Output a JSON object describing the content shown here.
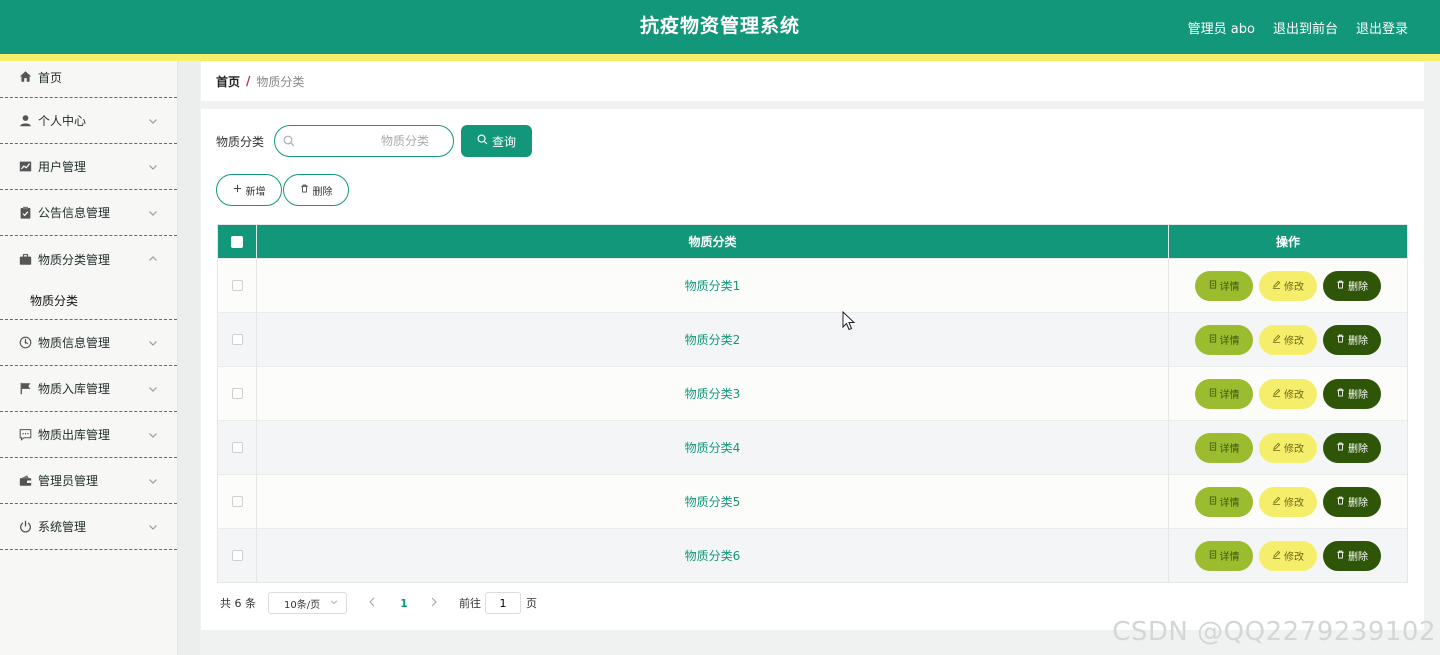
{
  "header": {
    "title": "抗疫物资管理系统",
    "admin_label": "管理员 abo",
    "back_to_front": "退出到前台",
    "logout": "退出登录"
  },
  "sidebar": {
    "items": [
      {
        "label": "首页",
        "icon": "home-icon"
      },
      {
        "label": "个人中心",
        "icon": "user-icon"
      },
      {
        "label": "用户管理",
        "icon": "chart-icon"
      },
      {
        "label": "公告信息管理",
        "icon": "clipboard-icon"
      },
      {
        "label": "物质分类管理",
        "icon": "briefcase-icon",
        "expanded": true
      },
      {
        "label": "物质信息管理",
        "icon": "compass-icon"
      },
      {
        "label": "物质入库管理",
        "icon": "flag-icon"
      },
      {
        "label": "物质出库管理",
        "icon": "chat-icon"
      },
      {
        "label": "管理员管理",
        "icon": "wallet-icon"
      },
      {
        "label": "系统管理",
        "icon": "power-icon"
      }
    ],
    "sub_item": "物质分类"
  },
  "breadcrumb": {
    "home": "首页",
    "separator": "/",
    "current": "物质分类"
  },
  "search": {
    "label": "物质分类",
    "placeholder": "物质分类",
    "button": "查询"
  },
  "actions": {
    "add": "新增",
    "delete": "删除"
  },
  "table": {
    "columns": [
      "物质分类",
      "操作"
    ],
    "rows": [
      "物质分类1",
      "物质分类2",
      "物质分类3",
      "物质分类4",
      "物质分类5",
      "物质分类6"
    ],
    "row_actions": {
      "detail": "详情",
      "edit": "修改",
      "delete": "删除"
    }
  },
  "pagination": {
    "total": "共 6 条",
    "page_size": "10条/页",
    "current_page": "1",
    "goto_label": "前往",
    "goto_value": "1",
    "page_suffix": "页"
  },
  "watermark": "CSDN @QQ2279239102",
  "colors": {
    "primary": "#13977a",
    "accent_yellow": "#f5ee6a",
    "detail_green": "#9bbc2f",
    "delete_dark": "#2e5508"
  }
}
